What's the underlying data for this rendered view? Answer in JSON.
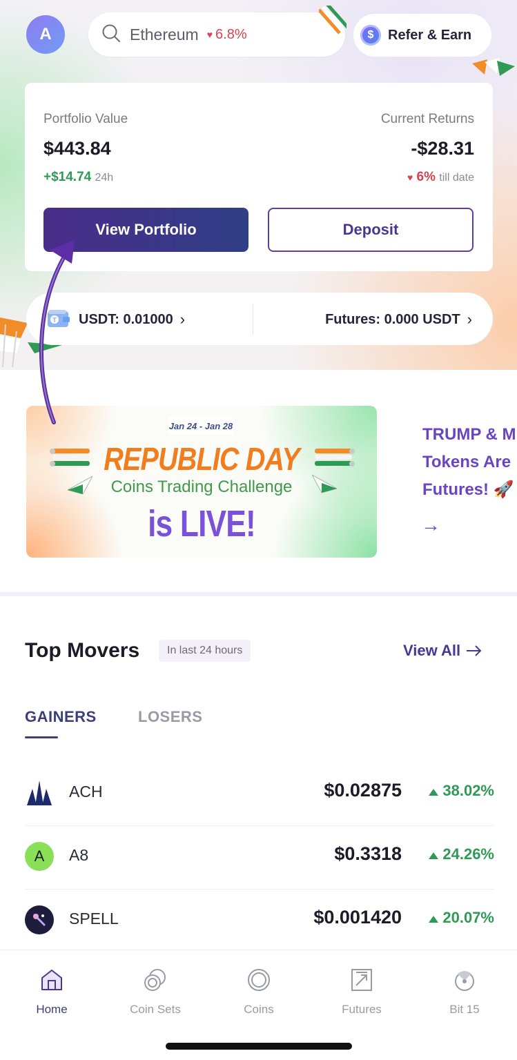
{
  "header": {
    "avatar_letter": "A",
    "search": {
      "text": "Ethereum",
      "change": "6.8%"
    },
    "refer_label": "Refer & Earn"
  },
  "portfolio": {
    "value_label": "Portfolio Value",
    "value": "$443.84",
    "change_24h": "+$14.74",
    "change_24h_suffix": "24h",
    "returns_label": "Current Returns",
    "returns": "-$28.31",
    "returns_pct": "6%",
    "returns_suffix": "till date",
    "view_button": "View Portfolio",
    "deposit_button": "Deposit"
  },
  "balances": {
    "usdt": "USDT: 0.01000",
    "futures": "Futures: 0.000 USDT"
  },
  "banner": {
    "date": "Jan 24 - Jan 28",
    "title": "REPUBLIC DAY",
    "subtitle": "Coins Trading Challenge",
    "live": "is LIVE!",
    "side_line1": "TRUMP & M",
    "side_line2": "Tokens Are",
    "side_line3": "Futures! 🚀",
    "side_arrow": "→"
  },
  "top_movers": {
    "title": "Top Movers",
    "chip": "In last 24 hours",
    "view_all": "View All",
    "tabs": [
      "GAINERS",
      "LOSERS"
    ],
    "rows": [
      {
        "symbol": "ACH",
        "price": "$0.02875",
        "change": "38.02%"
      },
      {
        "symbol": "A8",
        "price": "$0.3318",
        "change": "24.26%"
      },
      {
        "symbol": "SPELL",
        "price": "$0.001420",
        "change": "20.07%"
      }
    ]
  },
  "nav": {
    "items": [
      "Home",
      "Coin Sets",
      "Coins",
      "Futures",
      "Bit 15"
    ]
  },
  "colors": {
    "accent": "#4a3592",
    "gain": "#2f9a55",
    "loss": "#d9434e",
    "annotation_arrow": "#5b2ea6"
  }
}
